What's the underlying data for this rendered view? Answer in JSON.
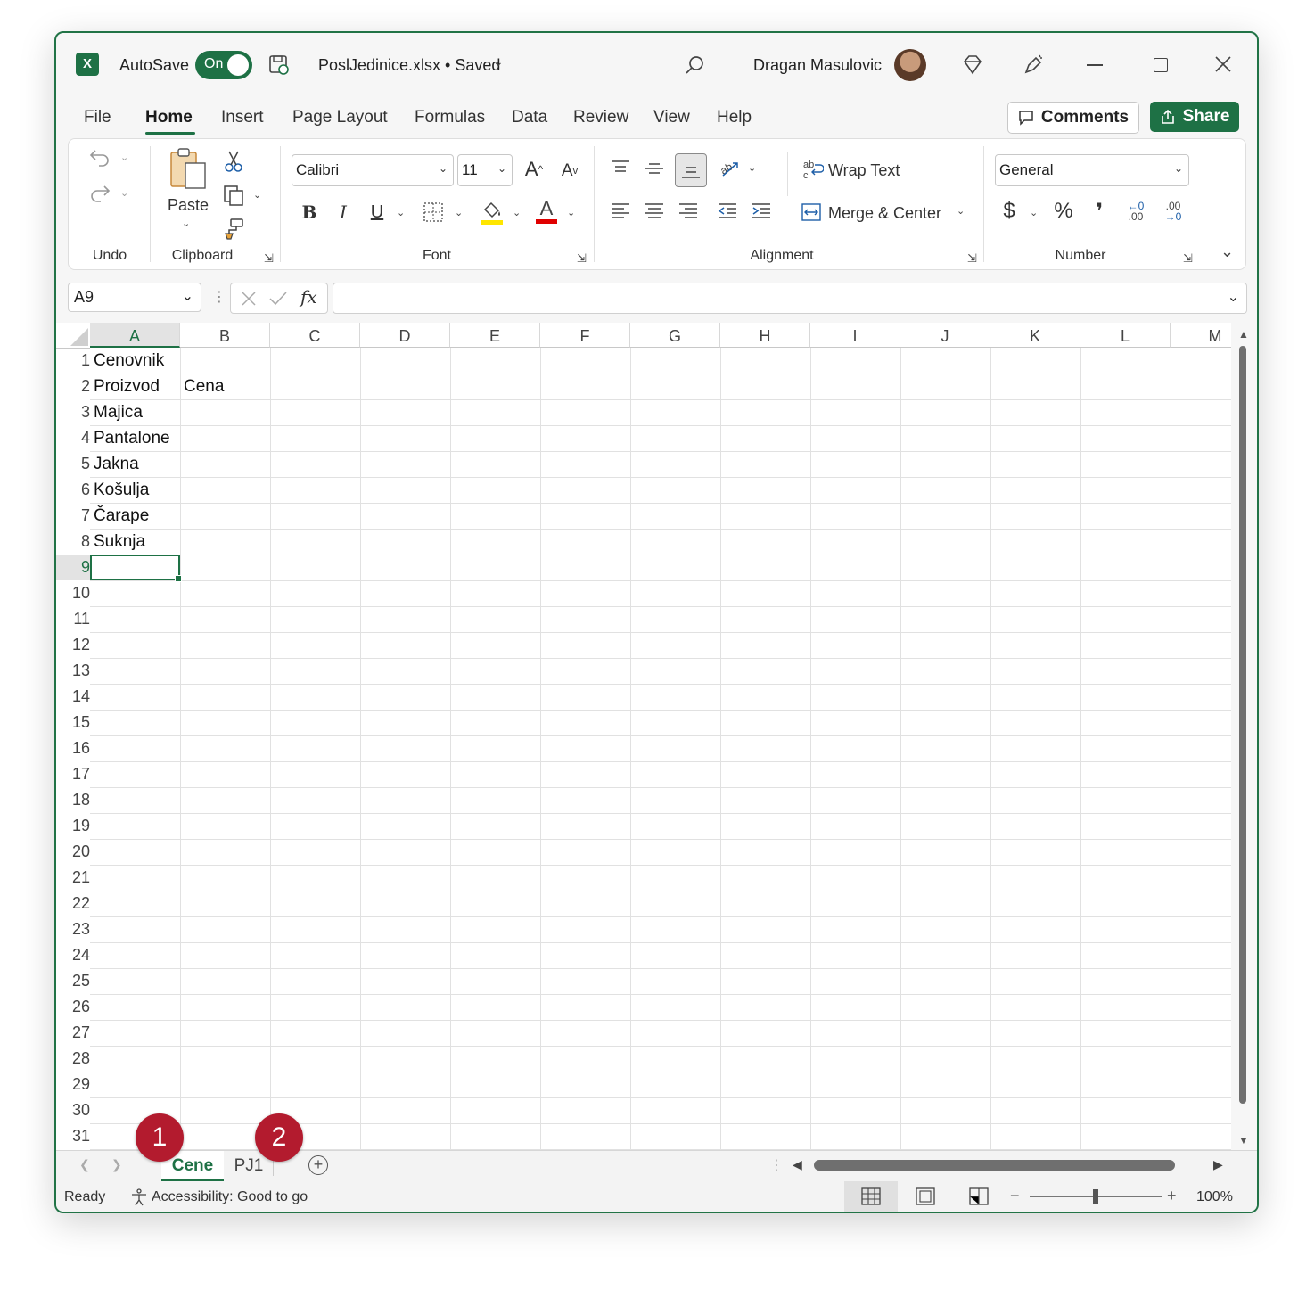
{
  "titlebar": {
    "app_icon": "excel-icon",
    "autosave_label": "AutoSave",
    "autosave_state": "On",
    "file_name": "PoslJedinice.xlsx • Saved",
    "user_name": "Dragan Masulovic"
  },
  "menu_tabs": [
    "File",
    "Home",
    "Insert",
    "Page Layout",
    "Formulas",
    "Data",
    "Review",
    "View",
    "Help"
  ],
  "actions": {
    "comments": "Comments",
    "share": "Share"
  },
  "ribbon": {
    "groups": {
      "undo": "Undo",
      "clipboard": "Clipboard",
      "font": "Font",
      "alignment": "Alignment",
      "number": "Number"
    },
    "paste_label": "Paste",
    "font_name": "Calibri",
    "font_size": "11",
    "wrap_text": "Wrap Text",
    "merge_center": "Merge & Center",
    "number_format": "General",
    "bold": "B",
    "italic": "I",
    "underline": "U",
    "currency": "$",
    "percent": "%",
    "comma": "❜",
    "inc_dec_left": "←0",
    "inc_dec_left2": ".00",
    "dec_dec_top": ".00",
    "dec_dec_bot": "→0",
    "grow_font": "A",
    "shrink_font": "A",
    "fx": "fx"
  },
  "formula_bar": {
    "name_box": "A9",
    "formula": ""
  },
  "columns": [
    "A",
    "B",
    "C",
    "D",
    "E",
    "F",
    "G",
    "H",
    "I",
    "J",
    "K",
    "L",
    "M"
  ],
  "selected_column": "A",
  "selected_row": 9,
  "cells": {
    "A1": "Cenovnik",
    "A2": "Proizvod",
    "B2": "Cena",
    "A3": "Majica",
    "A4": "Pantalone",
    "A5": "Jakna",
    "A6": "Košulja",
    "A7": "Čarape",
    "A8": "Suknja"
  },
  "sheets": [
    "Cene",
    "PJ1"
  ],
  "active_sheet": "Cene",
  "badges": [
    "1",
    "2"
  ],
  "status": {
    "ready": "Ready",
    "accessibility": "Accessibility: Good to go",
    "zoom": "100%",
    "zoom_minus": "−",
    "zoom_plus": "+",
    "zoom_level": 1.0
  },
  "colors": {
    "accent": "#1e7145",
    "badge": "#b31b2e",
    "highlight": "#ffe600",
    "font_color": "#e00000"
  }
}
